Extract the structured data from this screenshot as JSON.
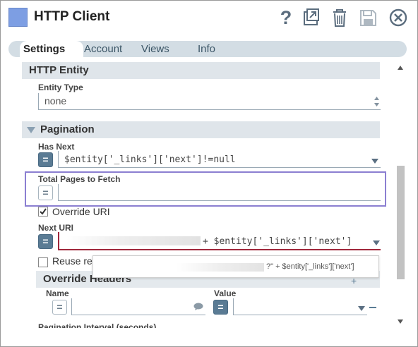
{
  "window": {
    "title": "HTTP Client"
  },
  "toolbar": {
    "icons": [
      "help-icon",
      "export-icon",
      "trash-icon",
      "save-icon",
      "close-icon"
    ],
    "help_label": "?"
  },
  "tabs": [
    {
      "label": "Settings",
      "active": true
    },
    {
      "label": "Account",
      "active": false
    },
    {
      "label": "Views",
      "active": false
    },
    {
      "label": "Info",
      "active": false
    }
  ],
  "http_entity": {
    "section_title": "HTTP Entity",
    "entity_type_label": "Entity Type",
    "entity_type_value": "none"
  },
  "pagination": {
    "section_title": "Pagination",
    "has_next_label": "Has Next",
    "has_next_value": "$entity['_links']['next']!=null",
    "total_pages_label": "Total Pages to Fetch",
    "total_pages_value": "",
    "override_uri_label": "Override URI",
    "override_uri_checked": true,
    "next_uri_label": "Next URI",
    "next_uri_value": "+ $entity['_links']['next']",
    "reuse_label": "Reuse re",
    "reuse_checked": false,
    "override_headers_title": "Override Headers",
    "name_label": "Name",
    "value_label": "Value",
    "interval_label": "Pagination Interval (seconds)"
  },
  "tooltip": {
    "text": "?\" + $entity['_links']['next']"
  },
  "colors": {
    "highlight_border": "#8b7fd1",
    "error_border": "#a0283c",
    "accent": "#5a7b94"
  }
}
